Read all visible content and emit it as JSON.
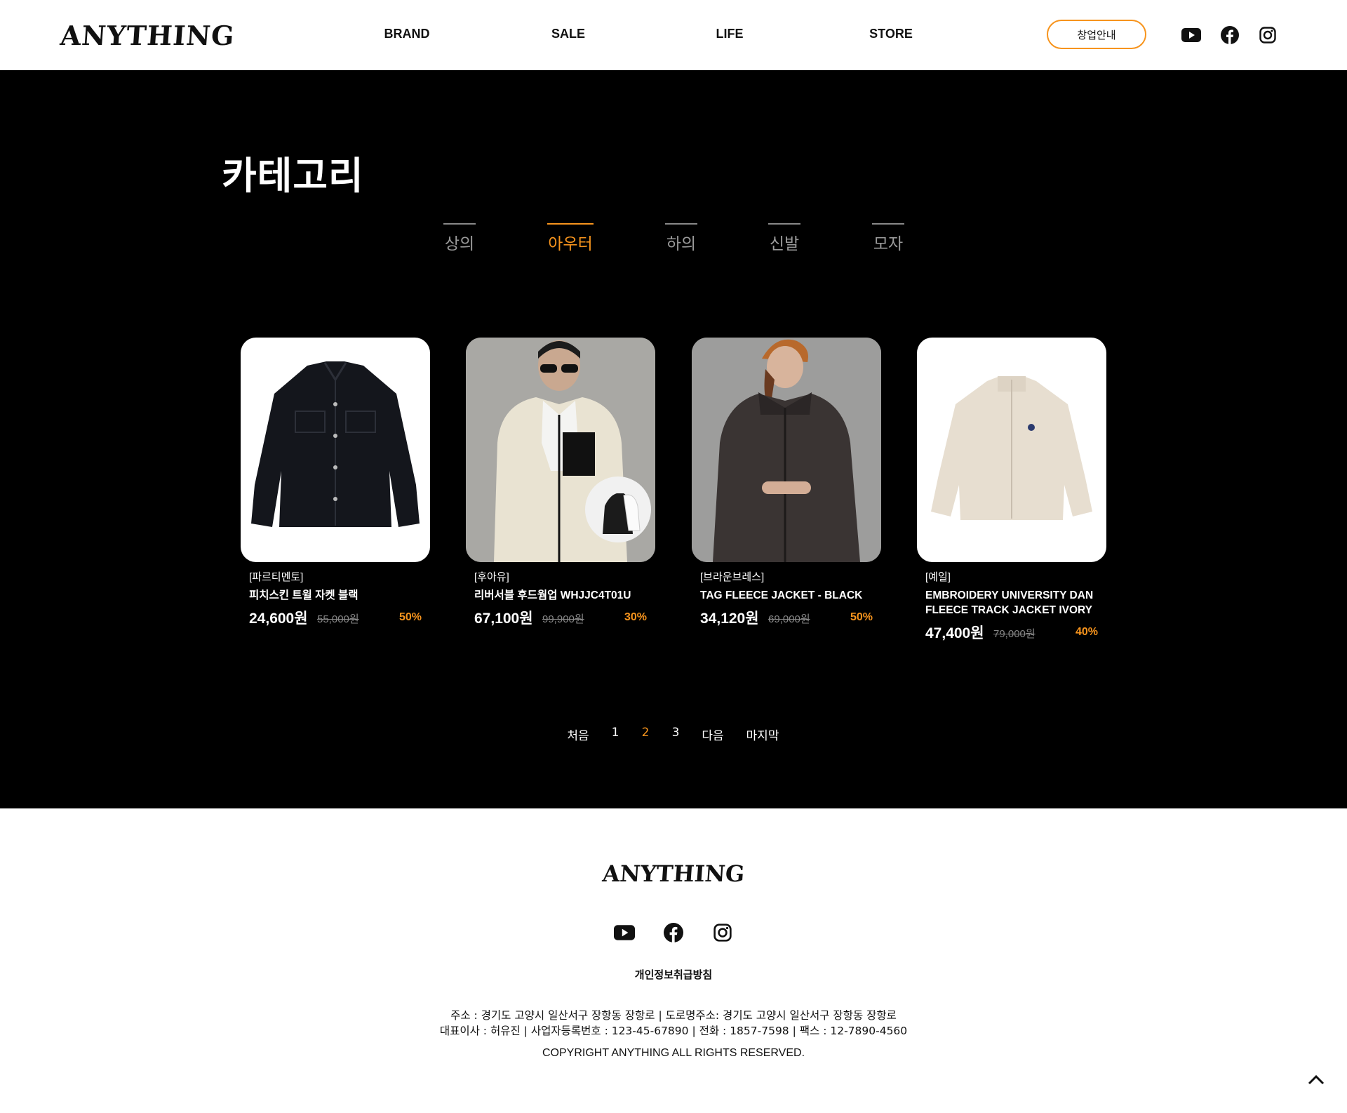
{
  "header": {
    "logo": "ANYTHING",
    "nav": [
      "BRAND",
      "SALE",
      "LIFE",
      "STORE"
    ],
    "cta_label": "창업안내",
    "social_icons": [
      "youtube-icon",
      "facebook-icon",
      "instagram-icon"
    ]
  },
  "main": {
    "title": "카테고리",
    "tabs": [
      {
        "label": "상의",
        "active": false
      },
      {
        "label": "아우터",
        "active": true
      },
      {
        "label": "하의",
        "active": false
      },
      {
        "label": "신발",
        "active": false
      },
      {
        "label": "모자",
        "active": false
      }
    ],
    "products": [
      {
        "brand": "[파르티멘토]",
        "name": "피치스킨 트윌 자켓 블랙",
        "price": "24,600원",
        "original": "55,000원",
        "discount": "50%"
      },
      {
        "brand": "[후아유]",
        "name": "리버서블 후드웜업 WHJJC4T01U",
        "price": "67,100원",
        "original": "99,900원",
        "discount": "30%"
      },
      {
        "brand": "[브라운브레스]",
        "name": "TAG FLEECE JACKET - BLACK",
        "price": "34,120원",
        "original": "69,000원",
        "discount": "50%"
      },
      {
        "brand": "[예일]",
        "name": "EMBROIDERY UNIVERSITY DAN FLEECE TRACK JACKET IVORY",
        "price": "47,400원",
        "original": "79,000원",
        "discount": "40%"
      }
    ],
    "pagination": {
      "first": "처음",
      "pages": [
        "1",
        "2",
        "3"
      ],
      "current": "2",
      "next": "다음",
      "last": "마지막"
    }
  },
  "footer": {
    "logo": "ANYTHING",
    "privacy": "개인정보취급방침",
    "address_line1": "주소 : 경기도 고양시 일산서구 장항동 장항로 | 도로명주소: 경기도 고양시 일산서구 장항동 장항로",
    "address_line2": "대표이사 : 허유진 | 사업자등록번호 : 123-45-67890 | 전화 : 1857-7598 | 팩스 : 12-7890-4560",
    "copyright": "COPYRIGHT ANYTHING ALL RIGHTS RESERVED."
  },
  "colors": {
    "accent": "#f7941d",
    "dark_bg": "#000000",
    "light_bg": "#ffffff"
  }
}
